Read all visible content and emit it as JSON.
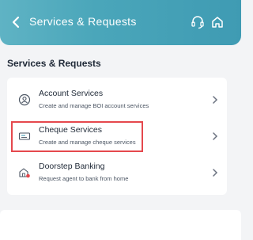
{
  "header": {
    "title": "Services & Requests",
    "back_icon": "arrow-left-icon",
    "support_icon": "headset-icon",
    "home_icon": "home-icon",
    "gradient_colors": [
      "#5fb3c4",
      "#3f9bb3"
    ]
  },
  "section": {
    "title": "Services & Requests"
  },
  "services": [
    {
      "title": "Account Services",
      "subtitle": "Create and manage BOI account services",
      "icon": "account-icon"
    },
    {
      "title": "Cheque Services",
      "subtitle": "Create and manage cheque services",
      "icon": "cheque-icon",
      "highlighted": true
    },
    {
      "title": "Doorstep Banking",
      "subtitle": "Request agent to bank from home",
      "icon": "doorstep-icon"
    }
  ],
  "colors": {
    "highlight": "#e5484d",
    "icon_accent": "#3f9bb3"
  }
}
